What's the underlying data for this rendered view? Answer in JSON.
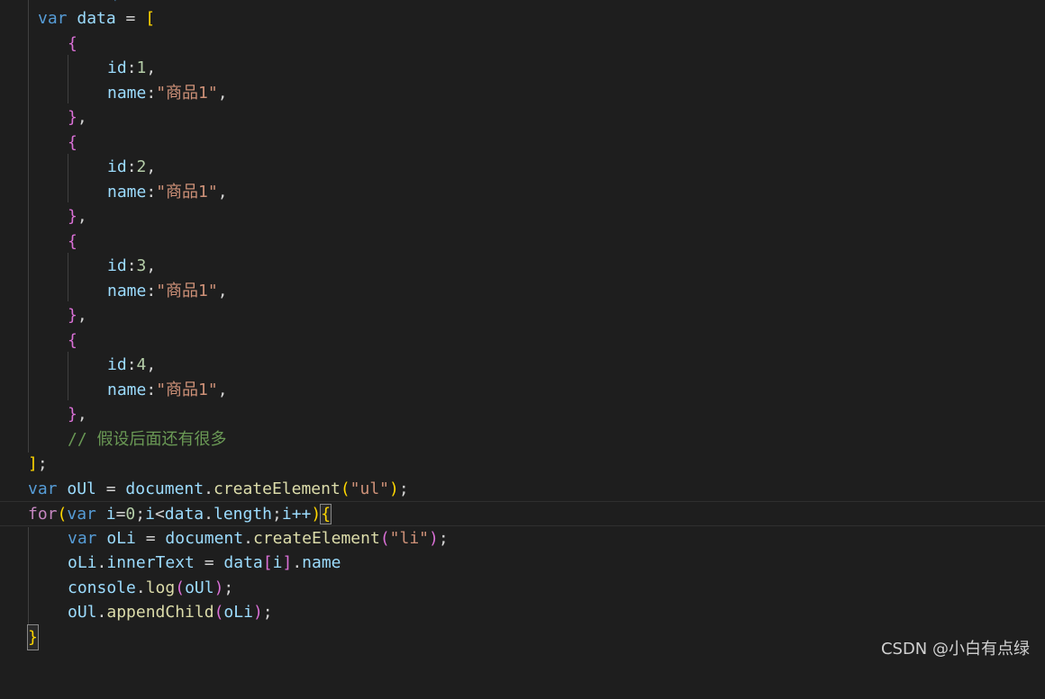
{
  "code": {
    "data_decl": {
      "keyword": "var",
      "name": "data",
      "eq": " = ",
      "open": "["
    },
    "items": [
      {
        "open": "{",
        "id_key": "id",
        "id_value": "1",
        "name_key": "name",
        "name_value": "\"商品1\"",
        "close": "}"
      },
      {
        "open": "{",
        "id_key": "id",
        "id_value": "2",
        "name_key": "name",
        "name_value": "\"商品1\"",
        "close": "}"
      },
      {
        "open": "{",
        "id_key": "id",
        "id_value": "3",
        "name_key": "name",
        "name_value": "\"商品1\"",
        "close": "}"
      },
      {
        "open": "{",
        "id_key": "id",
        "id_value": "4",
        "name_key": "name",
        "name_value": "\"商品1\"",
        "close": "}"
      }
    ],
    "comment": "// 假设后面还有很多",
    "array_close": "]",
    "ul_decl": {
      "keyword": "var",
      "name": "oUl",
      "eq": " = ",
      "object": "document",
      "method": "createElement",
      "arg": "\"ul\""
    },
    "for_line": {
      "keyword": "for",
      "var_keyword": "var",
      "iterator": "i",
      "start": "0",
      "limit_obj": "data",
      "limit_prop": "length",
      "inc": "i++"
    },
    "li_decl": {
      "keyword": "var",
      "name": "oLi",
      "eq": " = ",
      "object": "document",
      "method": "createElement",
      "arg": "\"li\""
    },
    "assign_line": {
      "target": "oLi",
      "prop": "innerText",
      "eq": " = ",
      "source": "data",
      "index": "i",
      "field": "name"
    },
    "log_line": {
      "object": "console",
      "method": "log",
      "arg": "oUl"
    },
    "append_line": {
      "object": "oUl",
      "method": "appendChild",
      "arg": "oLi"
    },
    "block_close": "}"
  },
  "watermark": "CSDN @小白有点绿",
  "colors": {
    "background": "#1e1e1e",
    "keyword": "#569cd6",
    "variable": "#9cdcfe",
    "function": "#dcdcaa",
    "string": "#ce9178",
    "number": "#b5cea8",
    "comment": "#6a9955",
    "bracket_level1": "#ffd700",
    "bracket_level2": "#da70d6",
    "bracket_level3": "#179fff"
  }
}
